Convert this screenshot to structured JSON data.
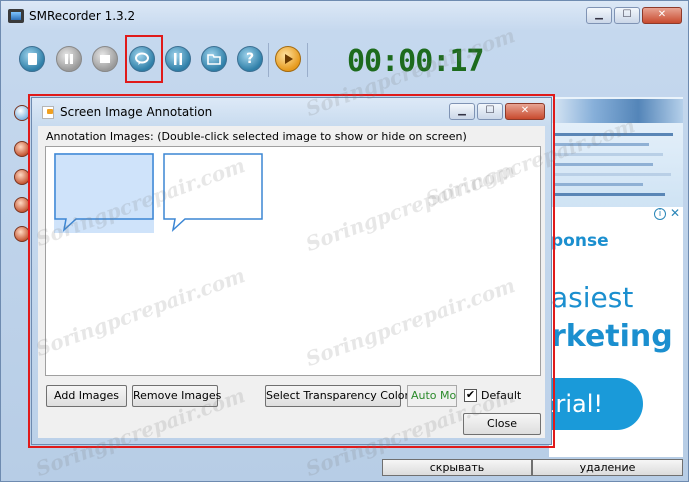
{
  "app": {
    "title": "SMRecorder 1.3.2",
    "window_controls": {
      "minimize": "▁",
      "maximize": "☐",
      "close": "✕"
    }
  },
  "toolbar": {
    "icons": [
      "file-icon",
      "pause-icon",
      "stop-icon",
      "speech-bubble-icon",
      "tools-icon",
      "folder-icon",
      "help-icon",
      "play-icon"
    ],
    "help_glyph": "?",
    "highlighted": "speech-bubble-icon"
  },
  "timer": "00:00:17",
  "dialog": {
    "title": "Screen Image Annotation",
    "label": "Annotation Images: (Double-click selected image to show or hide on screen)",
    "buttons": {
      "add": "Add Images",
      "remove": "Remove Images",
      "transparency": "Select Transparency Color",
      "auto_mode": "Auto Mod",
      "default": "Default",
      "close": "Close"
    },
    "default_checked": true,
    "check_glyph": "✔",
    "images": [
      {
        "name": "bubble-1",
        "selected": true
      },
      {
        "name": "bubble-2",
        "selected": false
      }
    ]
  },
  "ad": {
    "line1": "ponse",
    "line2": "asiest",
    "line3": "rketing",
    "cta": "y trial!",
    "icons": {
      "info": "i",
      "close": "✕"
    }
  },
  "bottom": {
    "left_button": "скрывать",
    "right_button": "удаление"
  },
  "watermark": "Soringpcrepair.com",
  "colors": {
    "accent_red": "#e01a1a",
    "timer_green": "#1d6b1d",
    "ad_blue": "#1b8fcf"
  }
}
